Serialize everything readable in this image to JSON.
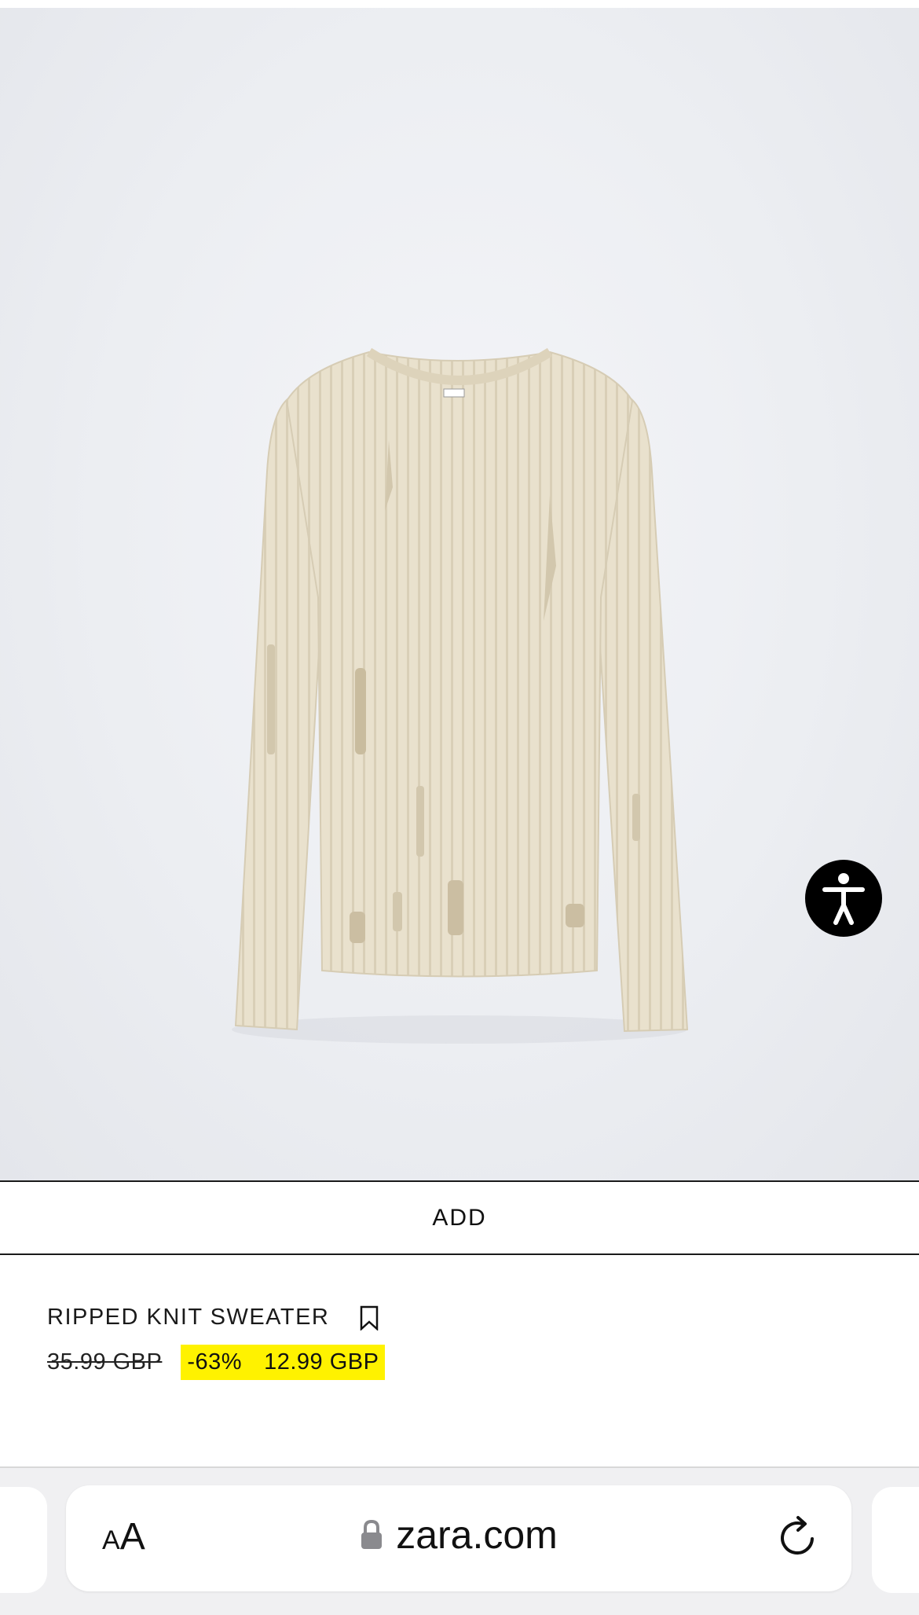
{
  "colors": {
    "sale_highlight": "#fff200",
    "image_background": "#eceef2",
    "sweater": "#e8e0cc",
    "accessibility_button": "#000000"
  },
  "product": {
    "add_label": "ADD",
    "title": "RIPPED KNIT SWEATER",
    "original_price": "35.99 GBP",
    "discount": "-63%",
    "sale_price": "12.99 GBP"
  },
  "icons": {
    "bookmark": "bookmark-icon",
    "accessibility": "accessibility-icon",
    "lock": "lock-icon",
    "reload": "reload-icon"
  },
  "browser": {
    "text_size_big": "A",
    "text_size_small": "A",
    "url": "zara.com"
  }
}
